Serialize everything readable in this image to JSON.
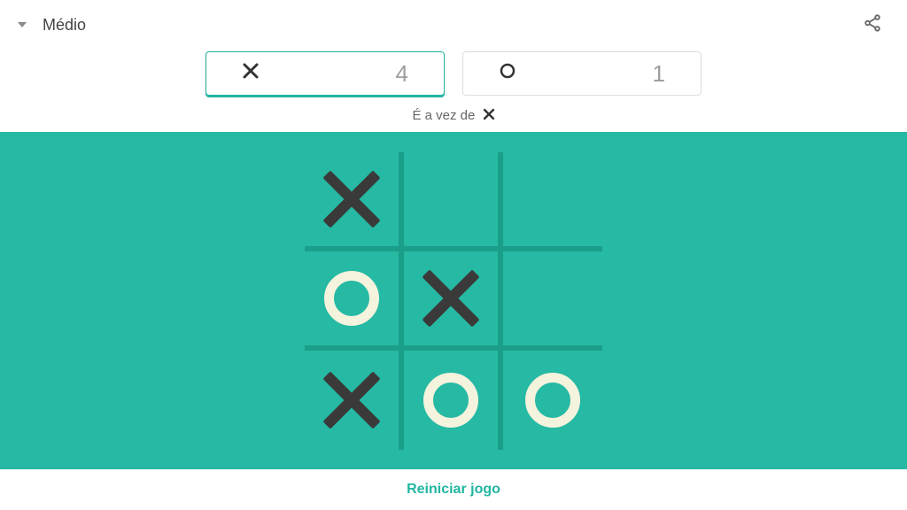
{
  "difficulty": {
    "label": "Médio"
  },
  "score": {
    "x": {
      "value": "4"
    },
    "o": {
      "value": "1"
    },
    "active": "x"
  },
  "turn": {
    "prefix": "É a vez de",
    "player": "X"
  },
  "board": {
    "cells": [
      "X",
      "",
      "",
      "O",
      "X",
      "",
      "X",
      "O",
      "O"
    ]
  },
  "restart": {
    "label": "Reiniciar jogo"
  },
  "colors": {
    "board_bg": "#26b9a4",
    "grid_line": "#1a9e8a",
    "x_color": "#3a3a3a",
    "o_color": "#f4f3dd",
    "accent": "#1fb6a0"
  }
}
